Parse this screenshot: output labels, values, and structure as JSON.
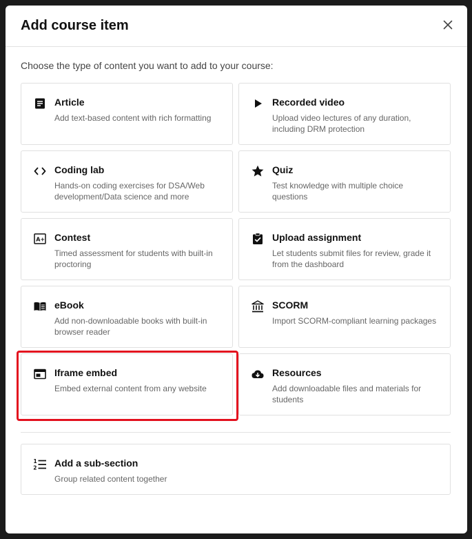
{
  "modal": {
    "title": "Add course item",
    "subtitle": "Choose the type of content you want to add to your course:"
  },
  "items": [
    {
      "title": "Article",
      "desc": "Add text-based content with rich formatting",
      "icon": "article-icon"
    },
    {
      "title": "Recorded video",
      "desc": "Upload video lectures of any duration, including DRM protection",
      "icon": "play-icon"
    },
    {
      "title": "Coding lab",
      "desc": "Hands-on coding exercises for DSA/Web development/Data science and more",
      "icon": "code-icon"
    },
    {
      "title": "Quiz",
      "desc": "Test knowledge with multiple choice questions",
      "icon": "star-icon"
    },
    {
      "title": "Contest",
      "desc": "Timed assessment for students with built-in proctoring",
      "icon": "grade-icon"
    },
    {
      "title": "Upload assignment",
      "desc": "Let students submit files for review, grade it from the dashboard",
      "icon": "clipboard-check-icon"
    },
    {
      "title": "eBook",
      "desc": "Add non-downloadable books with built-in browser reader",
      "icon": "book-icon"
    },
    {
      "title": "SCORM",
      "desc": "Import SCORM-compliant learning packages",
      "icon": "institution-icon"
    },
    {
      "title": "Iframe embed",
      "desc": "Embed external content from any website",
      "icon": "iframe-icon"
    },
    {
      "title": "Resources",
      "desc": "Add downloadable files and materials for students",
      "icon": "cloud-download-icon"
    }
  ],
  "subsection": {
    "title": "Add a sub-section",
    "desc": "Group related content together",
    "icon": "numbered-list-icon"
  },
  "highlight_color": "#e3101e"
}
